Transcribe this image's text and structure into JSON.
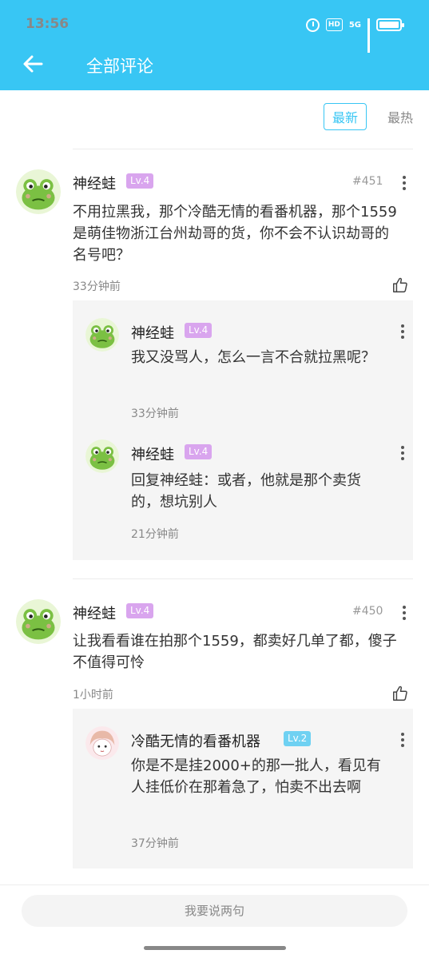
{
  "status_bar": {
    "time": "13:56",
    "hd": "HD",
    "network": "5G"
  },
  "header": {
    "title": "全部评论"
  },
  "sort": {
    "latest": "最新",
    "hottest": "最热"
  },
  "comments": [
    {
      "author": "神经蛙",
      "level": "Lv.4",
      "floor": "#451",
      "text": "不用拉黑我，那个冷酷无情的看番机器，那个1559是萌佳物浙江台州劫哥的货，你不会不认识劫哥的名号吧？",
      "time": "33分钟前",
      "replies": [
        {
          "author": "神经蛙",
          "level": "Lv.4",
          "text": "我又没骂人，怎么一言不合就拉黑呢？",
          "time": "33分钟前"
        },
        {
          "author": "神经蛙",
          "level": "Lv.4",
          "text": "回复神经蛙：或者，他就是那个卖货的，想坑别人",
          "time": "21分钟前"
        }
      ]
    },
    {
      "author": "神经蛙",
      "level": "Lv.4",
      "floor": "#450",
      "text": "让我看看谁在拍那个1559，都卖好几单了都，傻子不值得可怜",
      "time": "1小时前",
      "replies": [
        {
          "author": "冷酷无情的看番机器",
          "level": "Lv.2",
          "text": "你是不是挂2000+的那一批人，看见有人挂低价在那着急了，怕卖不出去啊",
          "time": "37分钟前"
        }
      ]
    }
  ],
  "composer": {
    "placeholder": "我要说两句"
  },
  "colors": {
    "accent": "#38c6f4",
    "level4": "#d9a5ee",
    "level2": "#6fd1f2"
  }
}
